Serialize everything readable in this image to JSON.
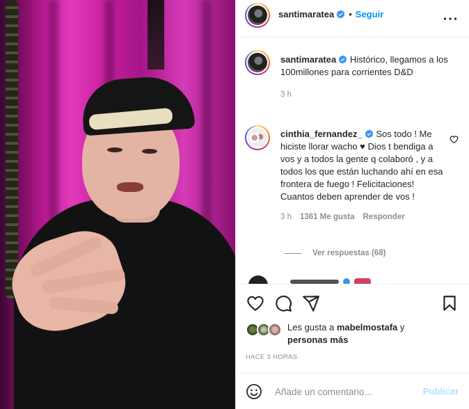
{
  "header": {
    "username": "santimaratea",
    "separator": "•",
    "follow_label": "Seguir"
  },
  "caption": {
    "username": "santimaratea",
    "text": "Histórico, llegamos a los 100millones para corrientes D&D",
    "time": "3 h"
  },
  "comment": {
    "username": "cinthia_fernandez_",
    "text": "Sos todo ! Me hiciste llorar wacho ♥ Dios t bendiga a vos y a todos la gente q colaboró , y a todos los que están luchando ahí en esa frontera de fuego ! Felicitaciones! Cuantos deben aprender de vos !",
    "time": "3 h",
    "likes": "1361 Me gusta",
    "reply_label": "Responder",
    "view_replies": "Ver respuestas (68)"
  },
  "likes": {
    "prefix": "Les gusta a",
    "liker": "mabelmostafa",
    "conjunction": "y",
    "others": "personas más"
  },
  "time_ago": "HACE 3 HORAS",
  "comment_box": {
    "placeholder": "Añade un comentario...",
    "post_label": "Publicar"
  },
  "colors": {
    "accent": "#0095f6",
    "verified": "#3897f0",
    "heart_red": "#c0153a",
    "post_disabled": "#b2dffc"
  },
  "icons": [
    "verified-badge-icon",
    "more-options-icon",
    "heart-icon",
    "comment-icon",
    "share-icon",
    "bookmark-icon",
    "emoji-icon"
  ]
}
